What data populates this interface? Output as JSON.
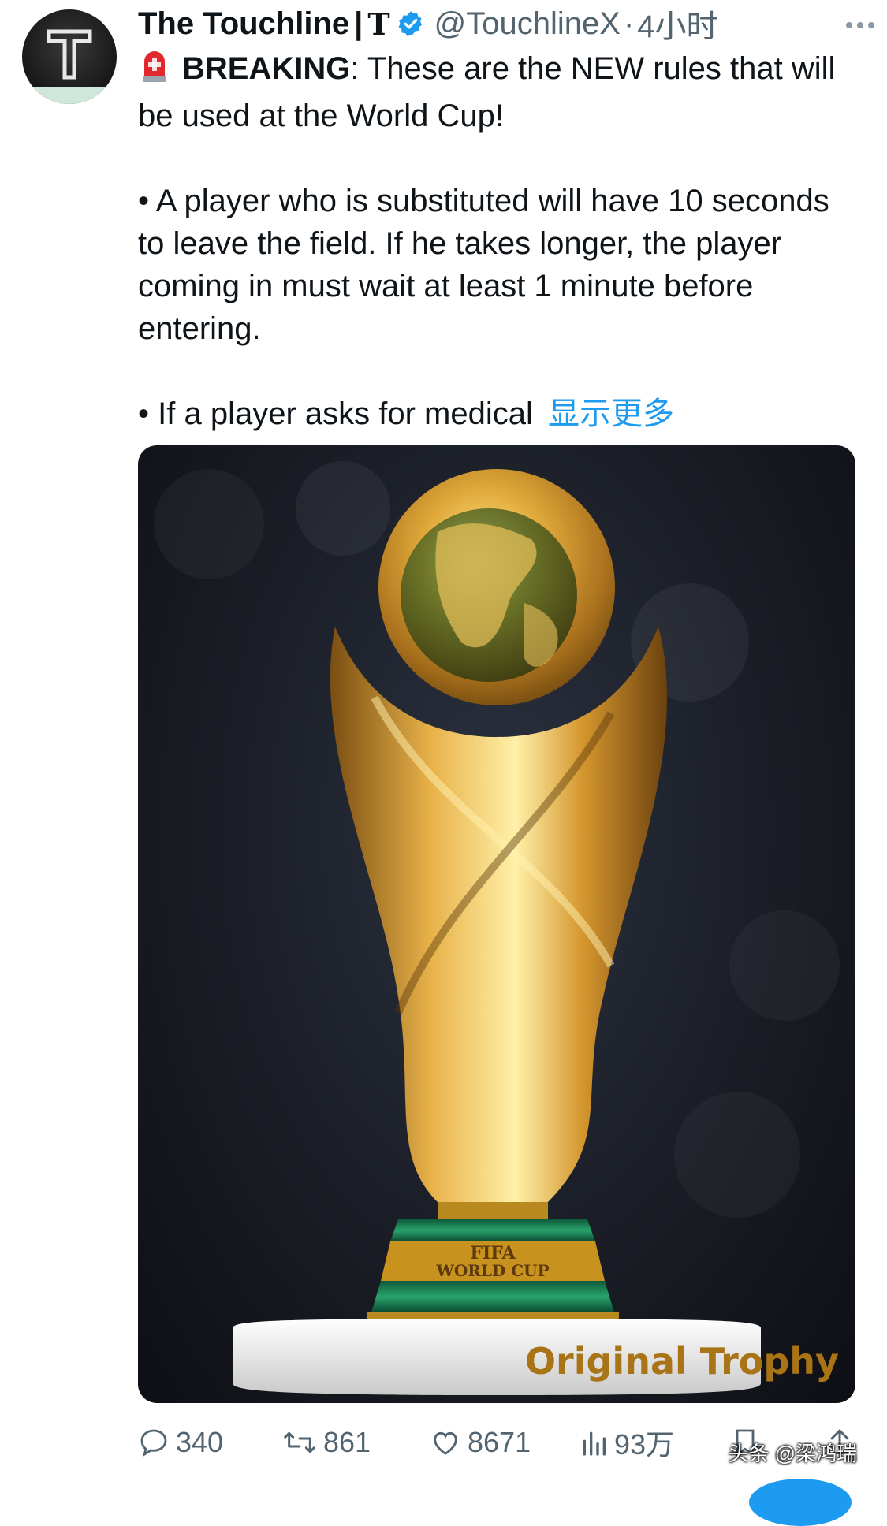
{
  "account": {
    "name": "The Touchline",
    "separator": "|",
    "logo_letter": "T",
    "handle": "@TouchlineX",
    "dot": "·",
    "time": "4小时"
  },
  "tweet": {
    "breaking_label": "BREAKING",
    "headline": ": These are the NEW rules that will be used at the World Cup!",
    "rule_1": "• A player who is substituted will have 10 seconds to leave the field. If he takes longer, the player coming in must wait at least 1 minute before entering.",
    "rule_2": "• If a player asks for medical",
    "show_more": "显示更多"
  },
  "media": {
    "trophy_band_text_1": "FIFA",
    "trophy_band_text_2": "WORLD CUP",
    "base_text": "Original Trophy"
  },
  "actions": {
    "replies": "340",
    "reposts": "861",
    "likes": "8671",
    "views": "93万"
  },
  "watermark": "头条 @梁鸿瑞",
  "colors": {
    "text": "#0f1419",
    "secondary": "#536471",
    "link": "#1d9bf0",
    "verified": "#1d9bf0",
    "gold": "#c8921f"
  },
  "icons": [
    "more-icon",
    "verified-badge-icon",
    "siren-icon",
    "reply-icon",
    "repost-icon",
    "like-icon",
    "views-icon",
    "bookmark-icon",
    "share-icon"
  ]
}
